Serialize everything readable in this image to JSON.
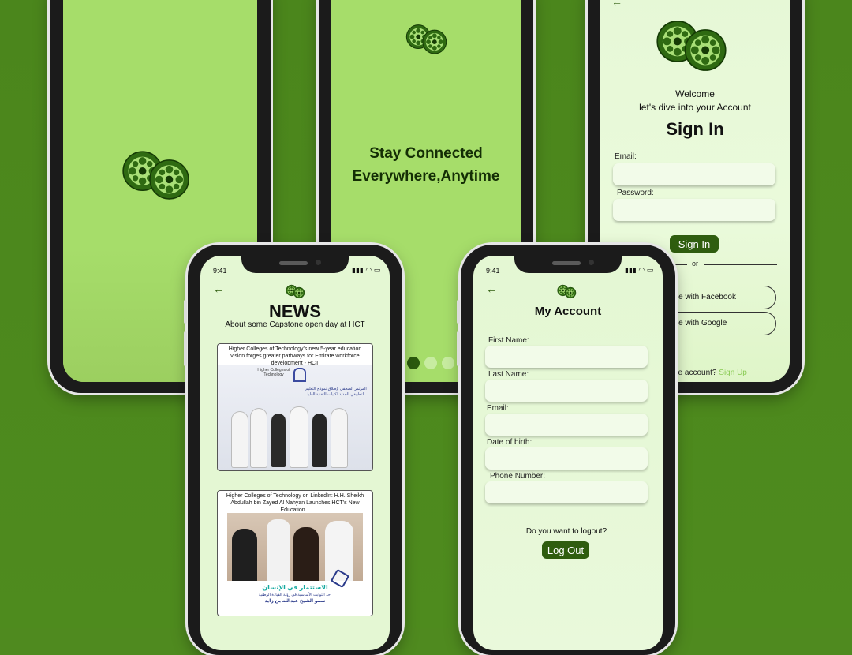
{
  "splash": {
    "logo": "film-reel-icon"
  },
  "onboarding": {
    "title_line1": "Stay Connected",
    "title_line2": "Everywhere,Anytime"
  },
  "signin": {
    "welcome": "Welcome",
    "subtitle": "let's dive into your Account",
    "title": "Sign In",
    "email_label": "Email:",
    "password_label": "Password:",
    "button": "Sign In",
    "or": "or",
    "facebook": "nue with Facebook",
    "google": "nue with Google",
    "footer_text": "ave account?",
    "footer_link": "Sign Up"
  },
  "news": {
    "time": "9:41",
    "title": "NEWS",
    "subtitle": "About some Capstone open day at HCT",
    "items": [
      {
        "caption": "Higher Colleges of Technology's new 5-year education vision forges greater pathways for Emirate workforce development - HCT",
        "banner_en": "Higher Colleges of Technology",
        "banner_ar": "المؤتمر الصحفي لإطلاق نموذج التعليم التطبيقي الجديد لكليات التقنية العليا"
      },
      {
        "caption": "Higher Colleges of Technology on LinkedIn: H.H. Sheikh Abdullah bin Zayed Al Nahyan Launches HCT's New Education...",
        "banner_ar1": "الاستثمار في الإنسان",
        "banner_ar2": "أحد الثوابت الأساسية في رؤية القيادة الوطنية",
        "banner_ar3": "سمو الشيخ عبدالله بن زايد"
      }
    ]
  },
  "account": {
    "time": "9:41",
    "title": "My Account",
    "fields": [
      "First Name:",
      "Last Name:",
      "Email:",
      "Date of birth:",
      "Phone Number:"
    ],
    "logout_prompt": "Do you want to logout?",
    "logout_button": "Log Out"
  },
  "colors": {
    "bg": "#4f8a1f",
    "accent": "#2f5d0f",
    "screen_light": "#e6f8d6",
    "screen_green": "#a5dd6a"
  }
}
